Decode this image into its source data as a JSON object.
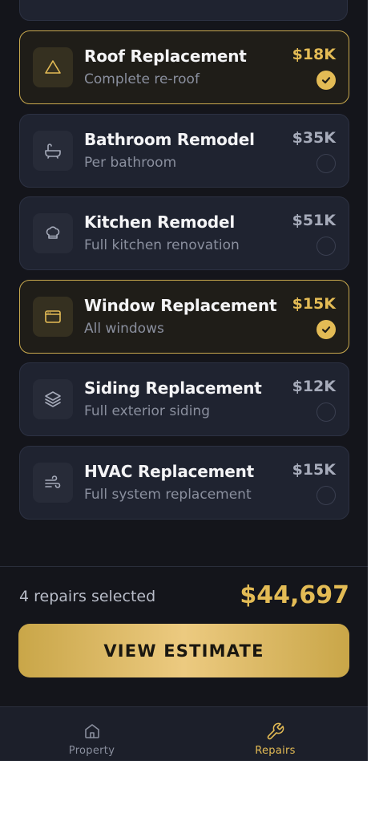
{
  "repairs": [
    {
      "title": "Roof Replacement",
      "subtitle": "Complete re-roof",
      "price": "$18K",
      "selected": true,
      "icon": "triangle-icon"
    },
    {
      "title": "Bathroom Remodel",
      "subtitle": "Per bathroom",
      "price": "$35K",
      "selected": false,
      "icon": "bathtub-icon"
    },
    {
      "title": "Kitchen Remodel",
      "subtitle": "Full kitchen renovation",
      "price": "$51K",
      "selected": false,
      "icon": "chef-hat-icon"
    },
    {
      "title": "Window Replacement",
      "subtitle": "All windows",
      "price": "$15K",
      "selected": true,
      "icon": "window-icon"
    },
    {
      "title": "Siding Replacement",
      "subtitle": "Full exterior siding",
      "price": "$12K",
      "selected": false,
      "icon": "layers-icon"
    },
    {
      "title": "HVAC Replacement",
      "subtitle": "Full system replacement",
      "price": "$15K",
      "selected": false,
      "icon": "wind-icon"
    }
  ],
  "summary": {
    "count_label": "4 repairs selected",
    "total": "$44,697"
  },
  "cta": {
    "label": "VIEW ESTIMATE"
  },
  "nav": {
    "items": [
      {
        "label": "Property",
        "icon": "home-icon",
        "active": false
      },
      {
        "label": "Repairs",
        "icon": "wrench-icon",
        "active": true
      }
    ]
  },
  "colors": {
    "accent": "#e3bb55",
    "background": "#14151b",
    "card": "#1f2330"
  }
}
